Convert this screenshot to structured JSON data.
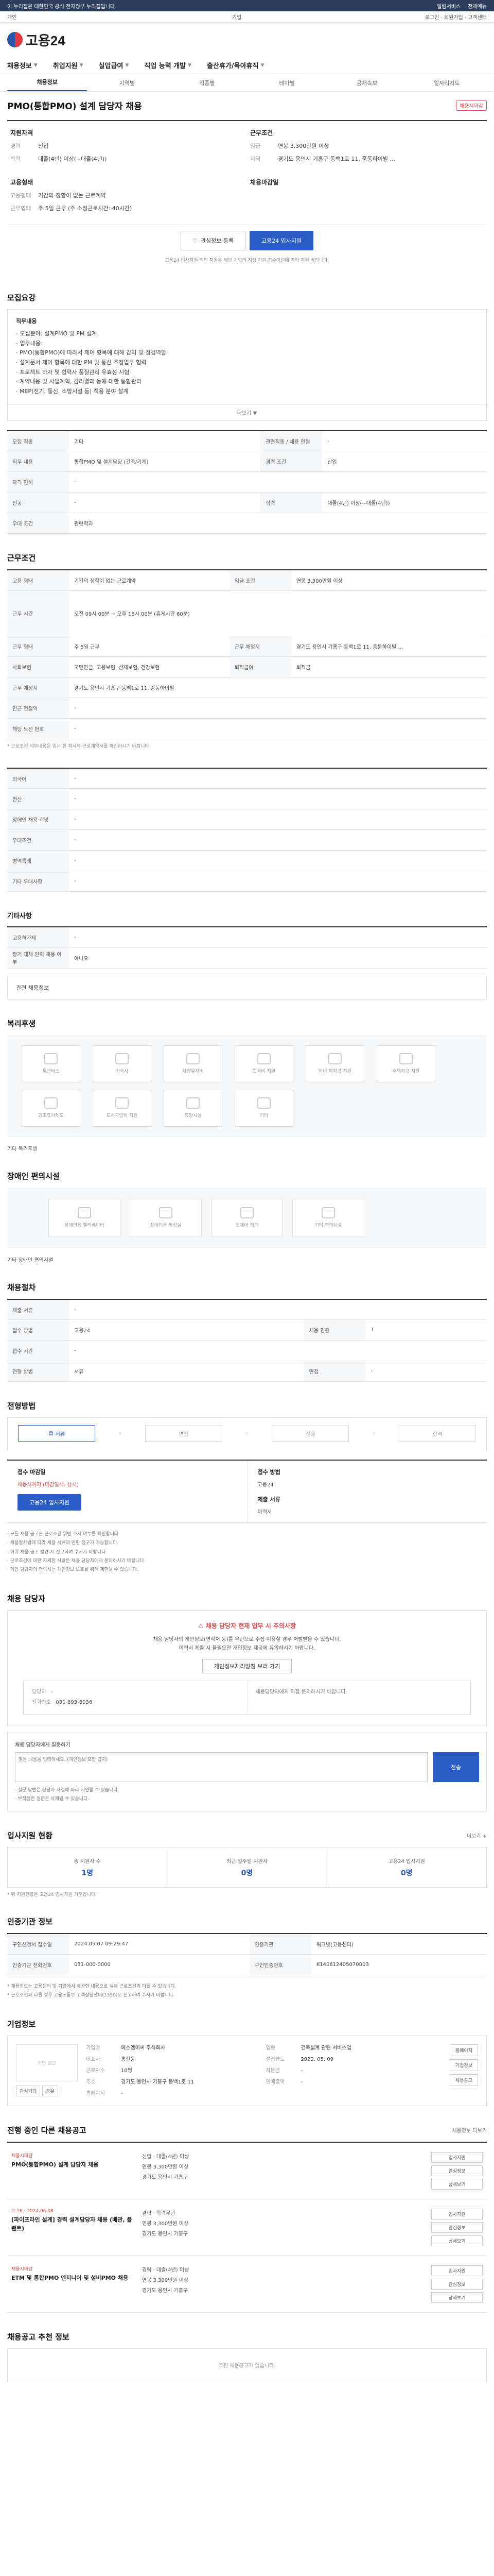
{
  "topbar": {
    "notice": "이 누리집은 대한민국 공식 전자정부 누리집입니다.",
    "links": [
      "알림서비스",
      "전체메뉴"
    ]
  },
  "gnb": {
    "left": "개인",
    "center": "기업",
    "right": "로그인 · 회원가입 · 고객센터"
  },
  "logo": {
    "text": "고용24"
  },
  "mainnav": [
    "채용정보",
    "취업지원",
    "실업급여",
    "직업 능력 개발",
    "출산휴가/육아휴직"
  ],
  "subnav": {
    "items": [
      "채용정보",
      "지역별",
      "직종별",
      "테마별",
      "공채속보",
      "일자리지도"
    ],
    "active_index": 0
  },
  "job": {
    "title": "PMO(통합PMO) 설계 담당자 채용",
    "badge": "채용시마감"
  },
  "summary": {
    "left_title": "지원자격",
    "left": [
      {
        "k": "경력",
        "v": "신입"
      },
      {
        "k": "학력",
        "v": "대졸(4년) 이상(~대졸(4년))"
      }
    ],
    "right_title": "근무조건",
    "right": [
      {
        "k": "임금",
        "v": "연봉 3,300만원 이상"
      },
      {
        "k": "지역",
        "v": "경기도 용인시 기흥구 동백1로 11, 중동하이빌 ..."
      }
    ],
    "mid_title": "고용형태",
    "mid": [
      {
        "k": "고용형태",
        "v": "기간의 정함이 없는 근로계약"
      },
      {
        "k": "근무형태",
        "v": "주 5일 근무 (주 소정근로시간: 40시간)"
      }
    ],
    "mid_right_title": "채용마감일",
    "buttons": {
      "scrap": "관심정보 등록",
      "apply": "고용24 입사지원"
    },
    "notice": "고용24 입사지원 외의 지원은 해당 기업의 지정 지원 접수방법에 따라 지원 바랍니다."
  },
  "sections": {
    "recruit": "모집요강",
    "work": "근무조건",
    "welfare": "복리후생",
    "disabled": "장애인 편의시설",
    "process": "채용절차",
    "apply": "전형방법",
    "contact": "채용 담당자",
    "status": "입사지원 현황",
    "info": "인증기관 정보",
    "company": "기업정보",
    "others": "진행 중인 다른 채용공고",
    "extra": "채용공고 추천 정보"
  },
  "recruit_box": {
    "heading": "직무내용",
    "lines": [
      "- 모집분야: 설계PMO 및 PM 설계",
      "- 업무내용:",
      "· PMO(통합PMO)에 따라서 제어 항목에 대해 감리 및 점검역할",
      "· 설계문서 제어 항목에 대한 PM 및 통신 조정업무 협력",
      "· 프로젝트 하자 및 협력사 품질관리 유효성 시험",
      "· 계약내용 및 사업계획, 감리결과 등에 대한 통합관리",
      "· MEP(전기, 통신, 소방시설 등) 적용 분야 설계"
    ],
    "fold": "더보기 ▼"
  },
  "recruit_table": [
    [
      "모집 직종",
      "기타",
      "관련직종 / 채용 인원",
      "-"
    ],
    [
      "직무 내용",
      "통합PMO 및 설계담당 (건축/기계)",
      "경력 조건",
      "신입"
    ],
    [
      "자격 면허",
      "-",
      "",
      ""
    ],
    [
      "전공",
      "-",
      "학력",
      "대졸(4년) 이상(~대졸(4년))"
    ],
    [
      "우대 조건",
      "관련학과",
      "",
      ""
    ]
  ],
  "work_table": {
    "rows": [
      [
        "고용 형태",
        "기간의 정함이 없는 근로계약",
        "임금 조건",
        "연봉 3,300만원 이상"
      ],
      [
        "근무 시간",
        "오전 09시 00분 ~ 오후 18시 00분 (휴게시간 60분)",
        "",
        ""
      ],
      [
        "근무 형태",
        "주 5일 근무",
        "근무 예정지",
        "경기도 용인시 기흥구 동백1로 11, 중동하이빌 ..."
      ],
      [
        "사회보험",
        "국민연금, 고용보험, 산재보험, 건강보험",
        "퇴직급여",
        "퇴직금"
      ],
      [
        "근무 예정지",
        "경기도 용인시 기흥구 동백1로 11, 중동하이빌",
        "",
        ""
      ],
      [
        "인근 전철역",
        "-",
        "",
        ""
      ],
      [
        "해당 노선 번호",
        "-",
        "",
        ""
      ]
    ],
    "note": "* 근로조건 세부내용은 입사 전 회사와 근로계약서를 확인하시기 바랍니다."
  },
  "prefer_table": [
    [
      "외국어",
      "-"
    ],
    [
      "전산",
      "-"
    ],
    [
      "장애인 채용 희망",
      "-"
    ],
    [
      "우대조건",
      "-"
    ],
    [
      "병역특례",
      "-"
    ],
    [
      "기타 우대사항",
      "-"
    ]
  ],
  "other_section_title": "기타사항",
  "other_table": [
    [
      "고용허가제",
      "-"
    ],
    [
      "장기 대체 인력 채용 여부",
      "아니오"
    ]
  ],
  "other_link": "관련 채용정보",
  "welfare": {
    "items": [
      "통근버스",
      "기숙사",
      "차량유지비",
      "교육비 지원",
      "자녀 학자금 지원",
      "주택자금 지원",
      "경조휴가제도",
      "도서구입비 지원",
      "휴양시설",
      "기타"
    ],
    "note": "기타 복리후생"
  },
  "disabled": {
    "items": [
      "장애인용 엘리베이터",
      "장애인용 화장실",
      "휠체어 접근",
      "기타 편의시설"
    ],
    "note": "기타 장애인 편의시설"
  },
  "process_table": [
    [
      "제출 서류",
      "-",
      "",
      ""
    ],
    [
      "접수 방법",
      "고용24",
      "채용 인원",
      "1"
    ],
    [
      "접수 기간",
      "-",
      "",
      ""
    ],
    [
      "전형 방법",
      "서류",
      "면접",
      "-"
    ]
  ],
  "steps": [
    "서류",
    "면접",
    "전형",
    "합격"
  ],
  "apply": {
    "c1_title": "접수 마감일",
    "c1_value": "채용시까지 (마감일시: 상시)",
    "c1_button": "고용24 입사지원",
    "c2_title": "접수 방법",
    "c2_value": "고용24",
    "c3_title": "제출 서류",
    "c3_value": "이력서"
  },
  "apply_notes": [
    "· 모든 채용 공고는 근로조건 위반 소지 여부를 확인합니다.",
    "· 채용절차법에 따라 채용 서류의 반환 청구가 가능합니다.",
    "· 허위 채용 공고 발견 시 신고하여 주시기 바랍니다.",
    "· 근로조건에 대한 자세한 사항은 채용 담당자에게 문의하시기 바랍니다.",
    "· 기업 담당자의 연락처는 개인정보 보호를 위해 제한될 수 있습니다."
  ],
  "contact": {
    "warn": "채용 담당자 현재 업무 시 주의사항",
    "lines": [
      "채용 담당자의 개인정보(연락처 등)를 무단으로 수집·이용할 경우 처벌받을 수 있습니다.",
      "이력서 제출 시 불필요한 개인정보 제공에 유의하시기 바랍니다."
    ],
    "button": "개인정보처리방침 보러 가기",
    "person_label": "담당자",
    "person_value": "-",
    "phone_label": "전화번호",
    "phone_value": "031-893-8036",
    "right_note": "채용담당자에게 직접 문의하시기 바랍니다."
  },
  "inquiry": {
    "label": "채용 담당자에게 질문하기",
    "placeholder": "질문 내용을 입력하세요. (개인정보 포함 금지)",
    "send": "전송",
    "notes": [
      "· 질문 답변은 담당자 사정에 따라 지연될 수 있습니다.",
      "· 부적절한 질문은 삭제될 수 있습니다."
    ]
  },
  "status_more": "더보기 +",
  "stats": [
    {
      "label": "총 지원자 수",
      "value": "1명"
    },
    {
      "label": "최근 일주일 지원자",
      "value": "0명"
    },
    {
      "label": "고용24 입사지원",
      "value": "0명"
    }
  ],
  "status_note": "* 위 지원현황은 고용24 입사지원 기준입니다.",
  "info_table": [
    [
      "구인신청서 접수일",
      "2024.05.07 09:29:47",
      "인증기관",
      "워크넷(고용센터)"
    ],
    [
      "인증기관 전화번호",
      "031-000-0000",
      "구인인증번호",
      "K140612405070003"
    ]
  ],
  "info_notes": [
    "* 채용정보는 고용센터 및 기업에서 제공한 내용으로 실제 근로조건과 다를 수 있습니다.",
    "* 근로조건과 다를 경우 고용노동부 고객상담센터(1350)로 신고하여 주시기 바랍니다."
  ],
  "company": {
    "logo_placeholder": "기업 로고",
    "mini_buttons": [
      "관심기업",
      "공유"
    ],
    "fields": [
      [
        "기업명",
        "에스엠이씨 주식회사",
        "업종",
        "건축설계 관련 서비스업"
      ],
      [
        "대표자",
        "홍길동",
        "설립연도",
        "2022. 05. 09"
      ],
      [
        "근로자수",
        "10명",
        "자본금",
        "-"
      ],
      [
        "주소",
        "경기도 용인시 기흥구 동백1로 11",
        "연매출액",
        "-"
      ],
      [
        "홈페이지",
        "-",
        "",
        ""
      ]
    ],
    "side_buttons": [
      "홈페이지",
      "기업정보",
      "채용공고"
    ]
  },
  "others_more": "채용정보 더보기",
  "others": [
    {
      "tag": "채용시마감",
      "title": "PMO(통합PMO) 설계 담당자 채용",
      "details": [
        "신입 · 대졸(4년) 이상",
        "연봉 3,300만원 이상",
        "경기도 용인시 기흥구"
      ],
      "buttons": [
        "입사지원",
        "관심정보",
        "상세보기"
      ]
    },
    {
      "tag": "D-16 · 2024.06.08",
      "title": "[파이프라인 설계] 경력 설계담당자 채용 (배관, 플랜트)",
      "details": [
        "경력 · 학력무관",
        "연봉 3,300만원 이상",
        "경기도 용인시 기흥구"
      ],
      "buttons": [
        "입사지원",
        "관심정보",
        "상세보기"
      ]
    },
    {
      "tag": "채용시마감",
      "title": "ETM 및 통합PMO 엔지니어 및 설비PMO 채용",
      "details": [
        "경력 · 대졸(4년) 이상",
        "연봉 3,300만원 이상",
        "경기도 용인시 기흥구"
      ],
      "buttons": [
        "입사지원",
        "관심정보",
        "상세보기"
      ]
    }
  ],
  "extra_empty": "추천 채용공고가 없습니다."
}
